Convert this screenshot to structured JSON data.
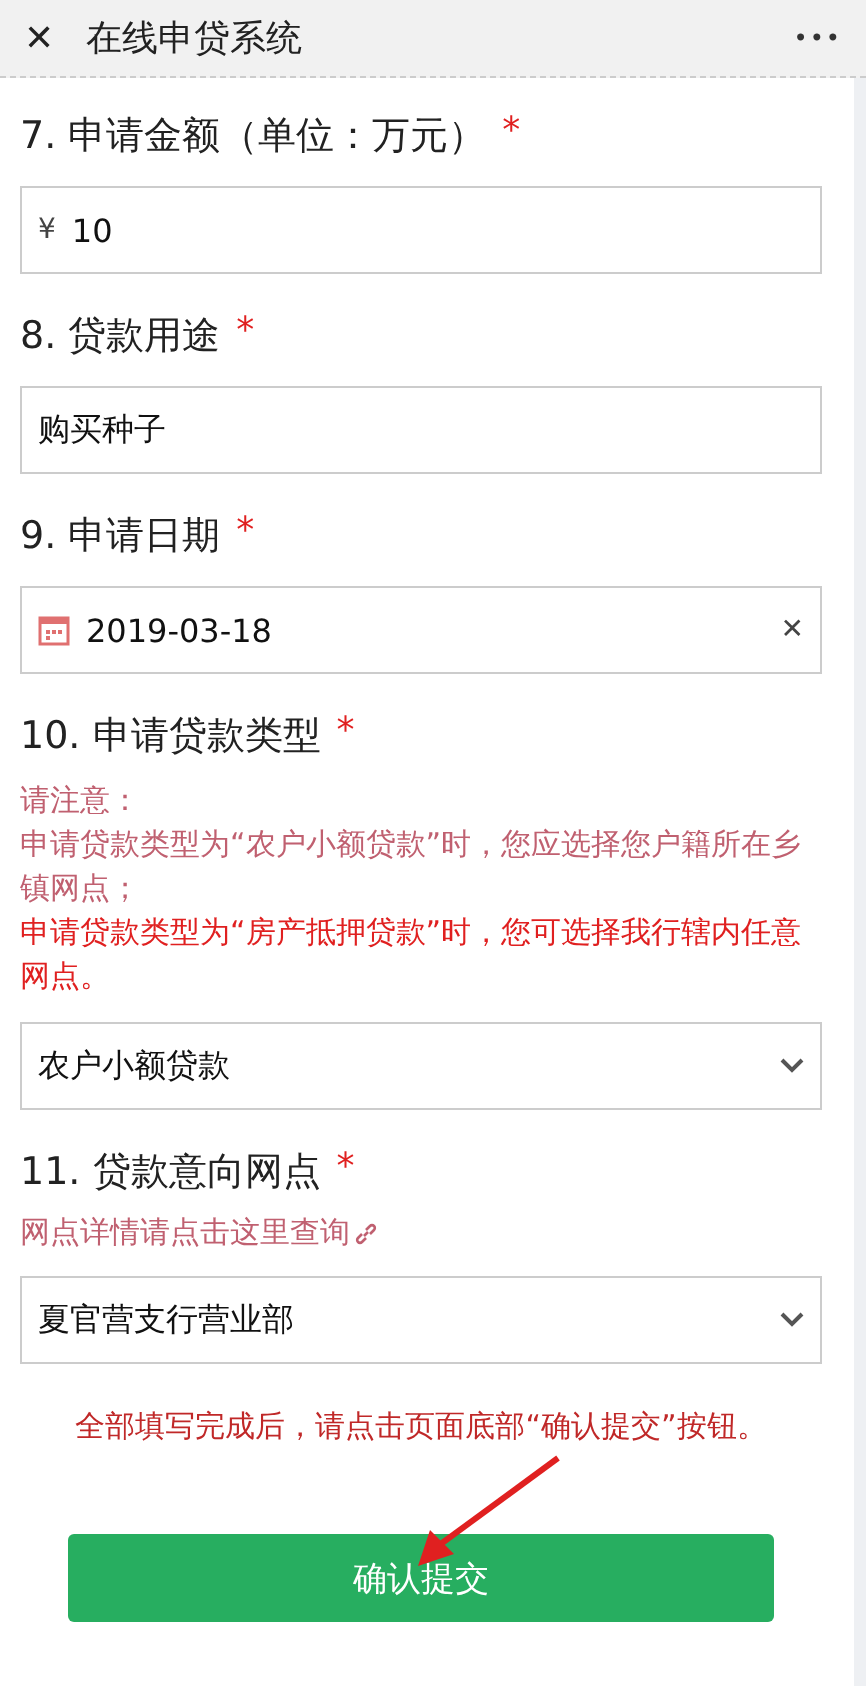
{
  "header": {
    "close": "✕",
    "title": "在线申贷系统",
    "menu": "•••"
  },
  "questions": [
    {
      "kind": "prefixed",
      "label": "7. 申请金额（单位：万元）",
      "required": "*",
      "prefix": "¥",
      "value": "10"
    },
    {
      "kind": "text",
      "label": "8. 贷款用途",
      "required": "*",
      "value": "购买种子"
    },
    {
      "kind": "date",
      "label": "9. 申请日期",
      "required": "*",
      "value": "2019-03-18",
      "clear": "✕"
    },
    {
      "kind": "select",
      "label": "10. 申请贷款类型",
      "required": "*",
      "notes": [
        "请注意：",
        "申请贷款类型为“农户小额贷款”时，您应选择您户籍所在乡镇网点；"
      ],
      "alerts": [
        "申请贷款类型为“房产抵押贷款”时，您可选择我行辖内任意网点。"
      ],
      "value": "农户小额贷款"
    },
    {
      "kind": "select",
      "label": "11. 贷款意向网点",
      "required": "*",
      "link": "网点详情请点击这里查询",
      "value": "夏官营支行营业部"
    }
  ],
  "footer_note": "全部填写完成后，请点击页面底部“确认提交”按钮。",
  "submit": "确认提交"
}
